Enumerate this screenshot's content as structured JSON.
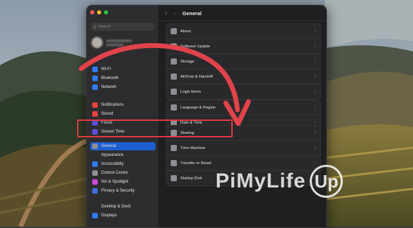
{
  "colors": {
    "accent": "#1d5fd0",
    "traffic_red": "#ff5f57",
    "traffic_yellow": "#febc2e",
    "traffic_green": "#28c840",
    "highlight": "#e53a43",
    "arrow": "#e1434b"
  },
  "sidebar": {
    "search": {
      "placeholder": "Search",
      "icon": "search-icon"
    },
    "items": [
      {
        "label": "Wi-Fi",
        "icon": "wifi-icon",
        "color": "#2f7cf6"
      },
      {
        "label": "Bluetooth",
        "icon": "bluetooth-icon",
        "color": "#2f7cf6"
      },
      {
        "label": "Network",
        "icon": "network-icon",
        "color": "#2f7cf6"
      },
      {
        "label": "Notifications",
        "icon": "notifications-icon",
        "color": "#e9413d"
      },
      {
        "label": "Sound",
        "icon": "sound-icon",
        "color": "#e9413d"
      },
      {
        "label": "Focus",
        "icon": "focus-icon",
        "color": "#5b4fd6"
      },
      {
        "label": "Screen Time",
        "icon": "screen-time-icon",
        "color": "#5b4fd6"
      },
      {
        "label": "General",
        "icon": "gear-icon",
        "color": "#8e8e93",
        "active": true
      },
      {
        "label": "Appearance",
        "icon": "appearance-icon",
        "color": "#2b2b2d"
      },
      {
        "label": "Accessibility",
        "icon": "accessibility-icon",
        "color": "#2f7cf6"
      },
      {
        "label": "Control Centre",
        "icon": "control-centre-icon",
        "color": "#8e8e93"
      },
      {
        "label": "Siri & Spotlight",
        "icon": "siri-icon",
        "color": "#c94bd6"
      },
      {
        "label": "Privacy & Security",
        "icon": "hand-icon",
        "color": "#3b6fe0"
      },
      {
        "label": "Desktop & Dock",
        "icon": "dock-icon",
        "color": "#2b2b2d"
      },
      {
        "label": "Displays",
        "icon": "display-icon",
        "color": "#2f7cf6"
      }
    ]
  },
  "main": {
    "title": "General",
    "back_icon": "chevron-left-icon",
    "forward_icon": "chevron-right-icon",
    "groups": [
      {
        "rows": [
          {
            "label": "About",
            "icon": "info-icon"
          },
          {
            "label": "Software Update",
            "icon": "gear-badge-icon"
          },
          {
            "label": "Storage",
            "icon": "storage-icon"
          },
          {
            "label": "AirDrop & Handoff",
            "icon": "airdrop-icon"
          },
          {
            "label": "Login Items",
            "icon": "list-icon"
          }
        ]
      },
      {
        "rows": [
          {
            "label": "Language & Region",
            "icon": "globe-icon"
          },
          {
            "label": "Date & Time",
            "icon": "calendar-icon"
          }
        ]
      },
      {
        "rows": [
          {
            "label": "Sharing",
            "icon": "sharing-icon"
          },
          {
            "label": "Time Machine",
            "icon": "time-machine-icon"
          },
          {
            "label": "Transfer or Reset",
            "icon": "reset-icon"
          },
          {
            "label": "Startup Disk",
            "icon": "disk-icon"
          }
        ]
      }
    ]
  },
  "watermark": {
    "text": "PiMyLife",
    "logo_text": "Up"
  }
}
